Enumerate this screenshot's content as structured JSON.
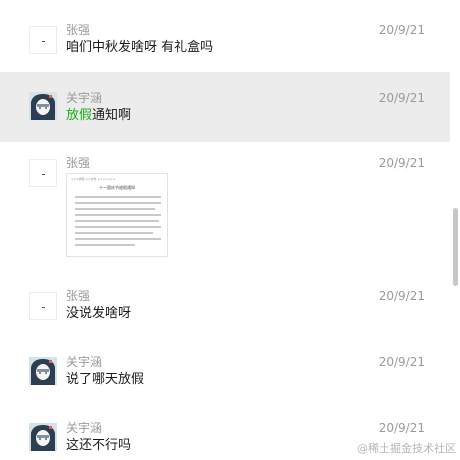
{
  "messages": [
    {
      "sender": "张强",
      "time": "20/9/21",
      "text": "咱们中秋发啥呀 有礼盒吗"
    },
    {
      "sender": "关宇涵",
      "time": "20/9/21",
      "text_highlight": "放假",
      "text_rest": "通知啊"
    },
    {
      "sender": "张强",
      "time": "20/9/21",
      "image": {
        "header": "×××学院  ××文件  ×××××××",
        "title": "十一国庆节放假通知"
      }
    },
    {
      "sender": "张强",
      "time": "20/9/21",
      "text": "没说发啥呀"
    },
    {
      "sender": "关宇涵",
      "time": "20/9/21",
      "text": "说了哪天放假"
    },
    {
      "sender": "关宇涵",
      "time": "20/9/21",
      "text": "这还不行吗"
    }
  ],
  "watermark": "@稀土掘金技术社区",
  "colors": {
    "highlight_bg": "#ececec",
    "green_text": "#1aad19",
    "meta_text": "#9a9a9a"
  },
  "icons": {
    "blank_avatar": "blank-avatar-icon",
    "photo_avatar": "anime-avatar-icon"
  }
}
